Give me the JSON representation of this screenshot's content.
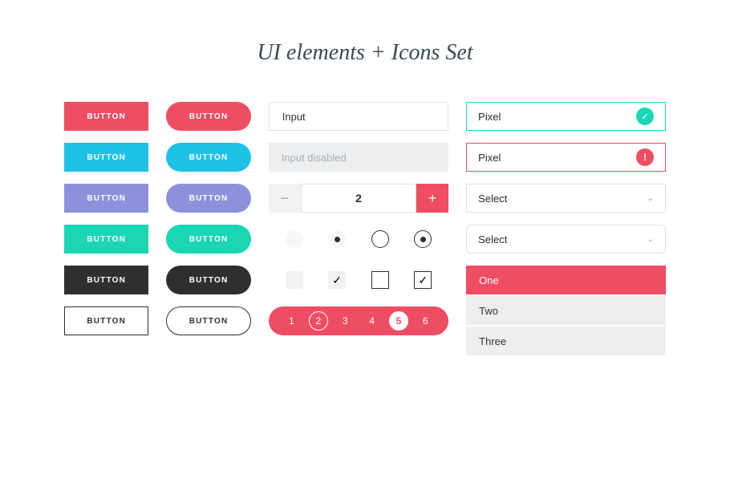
{
  "title": "UI elements + Icons Set",
  "buttons": {
    "label": "BUTTON"
  },
  "inputs": {
    "normal_placeholder": "Input",
    "disabled_placeholder": "Input disabled"
  },
  "stepper": {
    "value": "2"
  },
  "pagination": {
    "pages": [
      "1",
      "2",
      "3",
      "4",
      "5",
      "6"
    ]
  },
  "selects": {
    "pixel": "Pixel",
    "select": "Select"
  },
  "dropdown": {
    "items": [
      "One",
      "Two",
      "Three"
    ]
  }
}
